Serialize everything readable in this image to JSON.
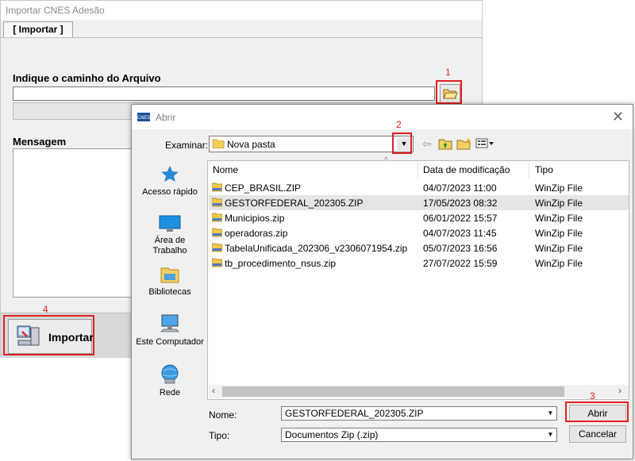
{
  "bg_window": {
    "title": "Importar CNES Adesão",
    "tab": "[ Importar ]",
    "path_label": "Indique o caminho do Arquivo",
    "path_value": "",
    "message_label": "Mensagem",
    "import_button": "Importar"
  },
  "annotations": [
    "1",
    "2",
    "3",
    "4"
  ],
  "dialog": {
    "title": "Abrir",
    "look_in_label": "Examinar:",
    "look_in_value": "Nova pasta",
    "places": [
      "Acesso rápido",
      "Área de Trabalho",
      "Bibliotecas",
      "Este Computador",
      "Rede"
    ],
    "columns": [
      "Nome",
      "Data de modificação",
      "Tipo"
    ],
    "files": [
      {
        "name": "CEP_BRASIL.ZIP",
        "date": "04/07/2023 11:00",
        "type": "WinZip File",
        "selected": false
      },
      {
        "name": "GESTORFEDERAL_202305.ZIP",
        "date": "17/05/2023 08:32",
        "type": "WinZip File",
        "selected": true
      },
      {
        "name": "Municipios.zip",
        "date": "06/01/2022 15:57",
        "type": "WinZip File",
        "selected": false
      },
      {
        "name": "operadoras.zip",
        "date": "04/07/2023 11:45",
        "type": "WinZip File",
        "selected": false
      },
      {
        "name": "TabelaUnificada_202306_v2306071954.zip",
        "date": "05/07/2023 16:56",
        "type": "WinZip File",
        "selected": false
      },
      {
        "name": "tb_procedimento_nsus.zip",
        "date": "27/07/2022 15:59",
        "type": "WinZip File",
        "selected": false
      }
    ],
    "filename_label": "Nome:",
    "filename_value": "GESTORFEDERAL_202305.ZIP",
    "filetype_label": "Tipo:",
    "filetype_value": "Documentos Zip (.zip)",
    "open_button": "Abrir",
    "cancel_button": "Cancelar"
  }
}
